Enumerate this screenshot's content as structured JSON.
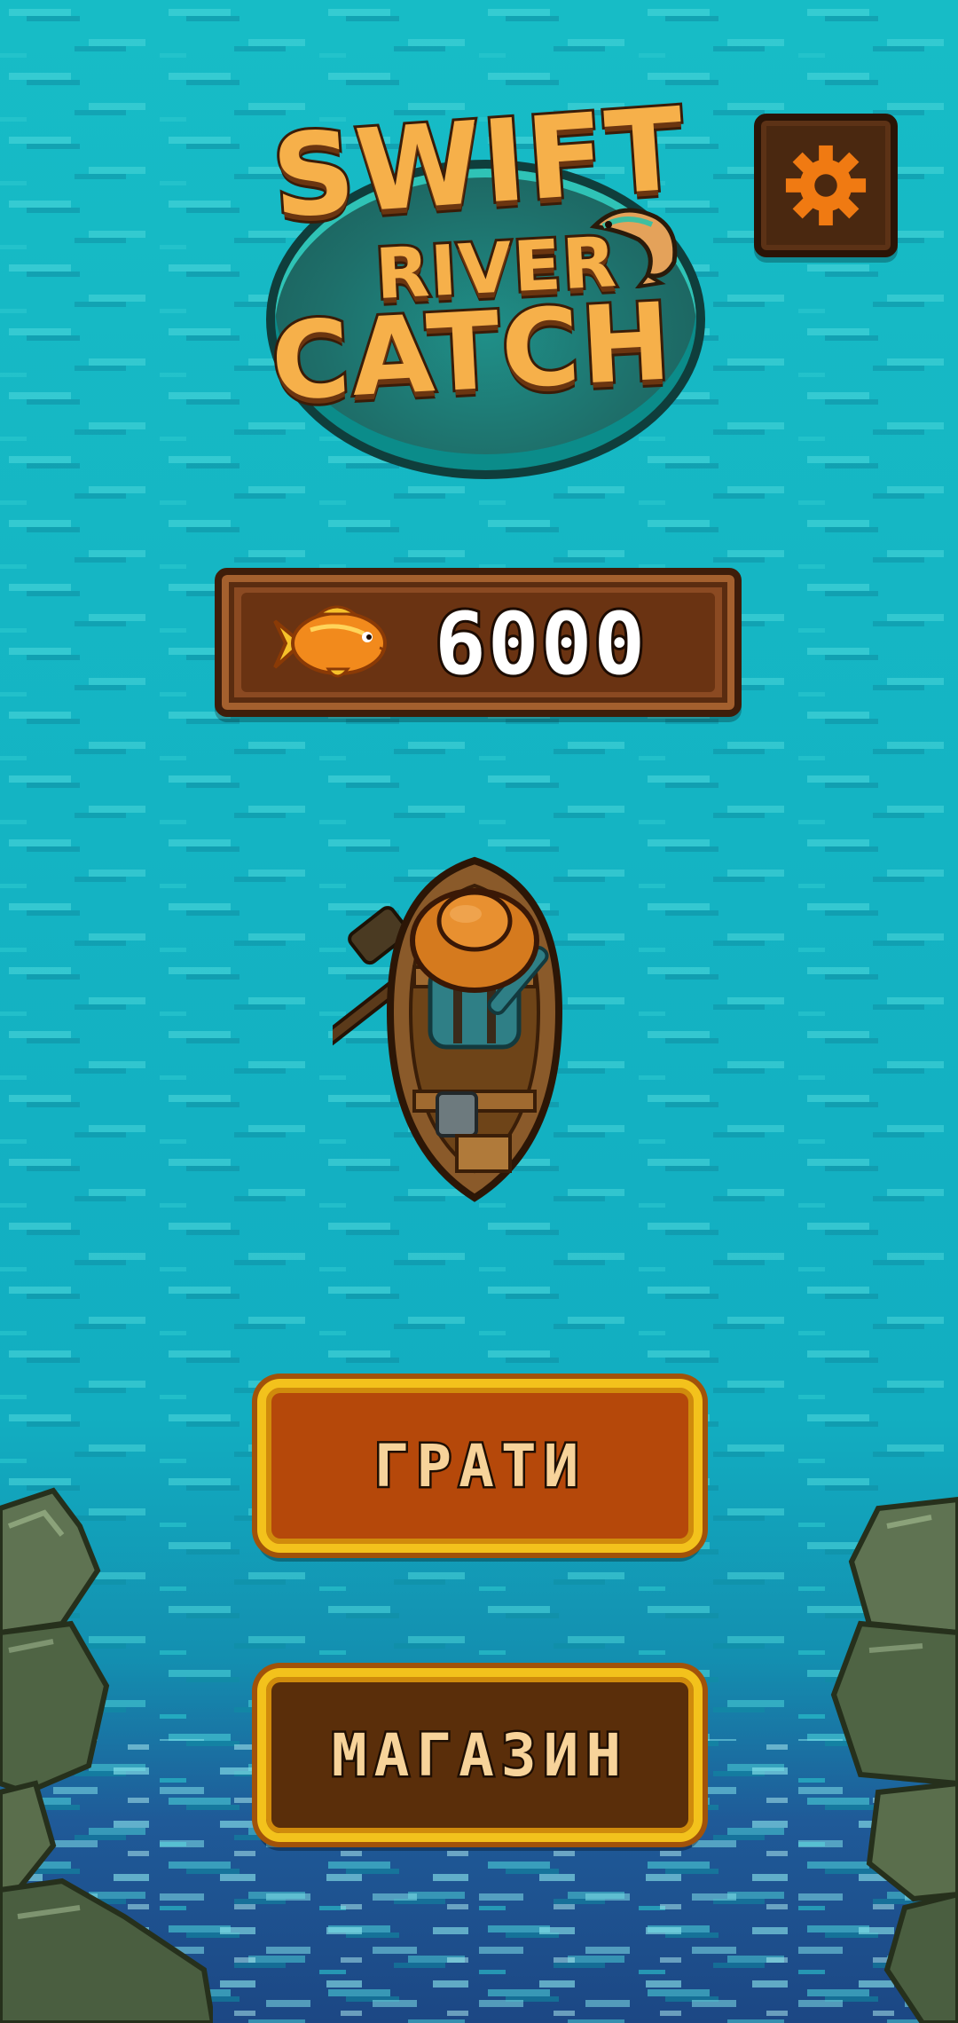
{
  "title": {
    "line1": "SWIFT",
    "line2": "RIVER",
    "line3": "CATCH"
  },
  "settings": {
    "icon": "gear-icon"
  },
  "balance": {
    "icon": "goldfish-icon",
    "value": "6000"
  },
  "menu": {
    "play_label": "ГРАТИ",
    "shop_label": "МАГАЗИН"
  },
  "colors": {
    "water": "#14b6c2",
    "water_dark": "#0f8fa3",
    "deep_water": "#1c4f8e",
    "title_orange": "#f6b04a",
    "button_border": "#f3c21c",
    "play_button": "#b5480a",
    "shop_button": "#5a2e0a",
    "panel_wood": "#8b4a22"
  }
}
